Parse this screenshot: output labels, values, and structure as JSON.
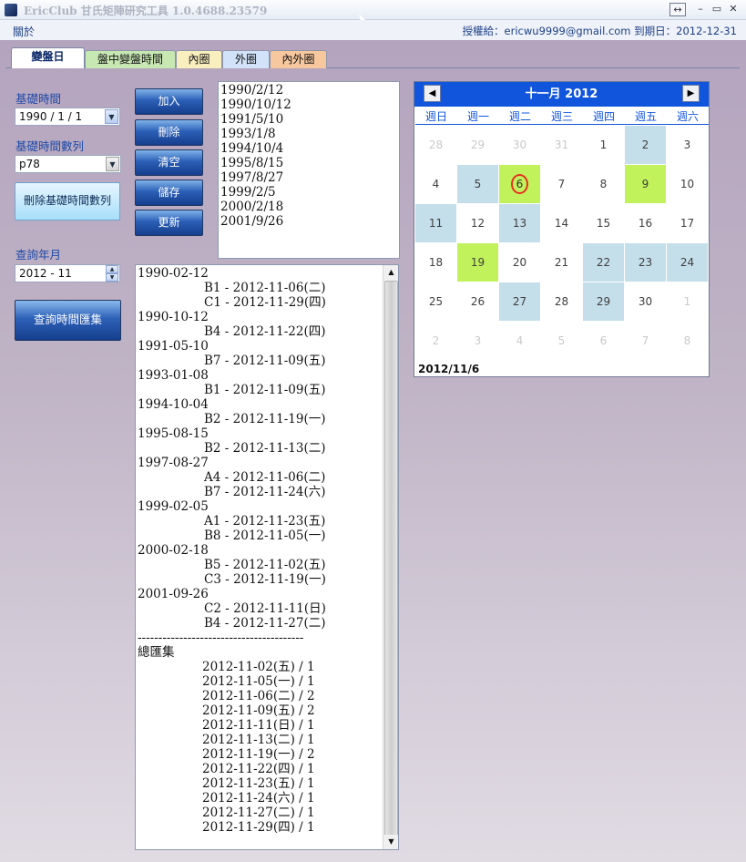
{
  "window": {
    "title": "EricClub 甘氏矩陣研究工具 1.0.4688.23579",
    "buttons": {
      "resize": "↔",
      "minimize": "–",
      "maximize": "▭",
      "close": "✕"
    }
  },
  "menu": {
    "about": "關於"
  },
  "license": "授權給：ericwu9999@gmail.com   到期日：2012-12-31",
  "tabs": [
    "變盤日",
    "盤中變盤時間",
    "內圈",
    "外圈",
    "內外圈"
  ],
  "tab_colors": [
    "#ffffff",
    "#c7e7b3",
    "#f9eebd",
    "#d2e3f9",
    "#f7c89e"
  ],
  "form": {
    "base_time_label": "基礎時間",
    "base_time_value": "1990 / 1 / 1",
    "series_label": "基礎時間數列",
    "series_value": "p78",
    "delete_series_button": "刪除基礎時間數列",
    "query_month_label": "查詢年月",
    "query_month_value": "2012 - 11",
    "query_button": "查詢時間匯集"
  },
  "actions": {
    "add": "加入",
    "delete": "刪除",
    "clear": "清空",
    "save": "儲存",
    "update": "更新"
  },
  "date_list": [
    "1990/2/12",
    "1990/10/12",
    "1991/5/10",
    "1993/1/8",
    "1994/10/4",
    "1995/8/15",
    "1997/8/27",
    "1999/2/5",
    "2000/2/18",
    "2001/9/26"
  ],
  "results": [
    {
      "text": "1990-02-12",
      "indent": false
    },
    {
      "text": "B1 - 2012-11-06(二)",
      "indent": true
    },
    {
      "text": "C1 - 2012-11-29(四)",
      "indent": true
    },
    {
      "text": "1990-10-12",
      "indent": false
    },
    {
      "text": "B4 - 2012-11-22(四)",
      "indent": true
    },
    {
      "text": "1991-05-10",
      "indent": false
    },
    {
      "text": "B7 - 2012-11-09(五)",
      "indent": true
    },
    {
      "text": "1993-01-08",
      "indent": false
    },
    {
      "text": "B1 - 2012-11-09(五)",
      "indent": true
    },
    {
      "text": "1994-10-04",
      "indent": false
    },
    {
      "text": "B2 - 2012-11-19(一)",
      "indent": true
    },
    {
      "text": "1995-08-15",
      "indent": false
    },
    {
      "text": "B2 - 2012-11-13(二)",
      "indent": true
    },
    {
      "text": "1997-08-27",
      "indent": false
    },
    {
      "text": "A4 - 2012-11-06(二)",
      "indent": true
    },
    {
      "text": "B7 - 2012-11-24(六)",
      "indent": true
    },
    {
      "text": "1999-02-05",
      "indent": false
    },
    {
      "text": "A1 - 2012-11-23(五)",
      "indent": true
    },
    {
      "text": "B8 - 2012-11-05(一)",
      "indent": true
    },
    {
      "text": "2000-02-18",
      "indent": false
    },
    {
      "text": "B5 - 2012-11-02(五)",
      "indent": true
    },
    {
      "text": "C3 - 2012-11-19(一)",
      "indent": true
    },
    {
      "text": "2001-09-26",
      "indent": false
    },
    {
      "text": "C2 - 2012-11-11(日)",
      "indent": true
    },
    {
      "text": "B4 - 2012-11-27(二)",
      "indent": true
    },
    {
      "text": "----------------------------------------",
      "indent": false
    },
    {
      "text": "總匯集",
      "indent": false
    },
    {
      "text": "2012-11-02(五) / 1",
      "indent": true
    },
    {
      "text": "2012-11-05(一) / 1",
      "indent": true
    },
    {
      "text": "2012-11-06(二) / 2",
      "indent": true
    },
    {
      "text": "2012-11-09(五) / 2",
      "indent": true
    },
    {
      "text": "2012-11-11(日) / 1",
      "indent": true
    },
    {
      "text": "2012-11-13(二) / 1",
      "indent": true
    },
    {
      "text": "2012-11-19(一) / 2",
      "indent": true
    },
    {
      "text": "2012-11-22(四) / 1",
      "indent": true
    },
    {
      "text": "2012-11-23(五) / 1",
      "indent": true
    },
    {
      "text": "2012-11-24(六) / 1",
      "indent": true
    },
    {
      "text": "2012-11-27(二) / 1",
      "indent": true
    },
    {
      "text": "2012-11-29(四) / 1",
      "indent": true
    }
  ],
  "calendar": {
    "title": "十一月 2012",
    "prev": "◀",
    "next": "▶",
    "weekdays": [
      "週日",
      "週一",
      "週二",
      "週三",
      "週四",
      "週五",
      "週六"
    ],
    "days": [
      {
        "d": "28",
        "s": "other"
      },
      {
        "d": "29",
        "s": "other"
      },
      {
        "d": "30",
        "s": "other"
      },
      {
        "d": "31",
        "s": "other"
      },
      {
        "d": "1",
        "s": ""
      },
      {
        "d": "2",
        "s": "blue"
      },
      {
        "d": "3",
        "s": ""
      },
      {
        "d": "4",
        "s": ""
      },
      {
        "d": "5",
        "s": "blue"
      },
      {
        "d": "6",
        "s": "green"
      },
      {
        "d": "7",
        "s": ""
      },
      {
        "d": "8",
        "s": ""
      },
      {
        "d": "9",
        "s": "green"
      },
      {
        "d": "10",
        "s": ""
      },
      {
        "d": "11",
        "s": "blue"
      },
      {
        "d": "12",
        "s": ""
      },
      {
        "d": "13",
        "s": "blue"
      },
      {
        "d": "14",
        "s": ""
      },
      {
        "d": "15",
        "s": ""
      },
      {
        "d": "16",
        "s": ""
      },
      {
        "d": "17",
        "s": ""
      },
      {
        "d": "18",
        "s": ""
      },
      {
        "d": "19",
        "s": "green"
      },
      {
        "d": "20",
        "s": ""
      },
      {
        "d": "21",
        "s": ""
      },
      {
        "d": "22",
        "s": "blue"
      },
      {
        "d": "23",
        "s": "blue"
      },
      {
        "d": "24",
        "s": "blue"
      },
      {
        "d": "25",
        "s": ""
      },
      {
        "d": "26",
        "s": ""
      },
      {
        "d": "27",
        "s": "blue"
      },
      {
        "d": "28",
        "s": ""
      },
      {
        "d": "29",
        "s": "blue"
      },
      {
        "d": "30",
        "s": ""
      },
      {
        "d": "1",
        "s": "other"
      },
      {
        "d": "2",
        "s": "other"
      },
      {
        "d": "3",
        "s": "other"
      },
      {
        "d": "4",
        "s": "other"
      },
      {
        "d": "5",
        "s": "other"
      },
      {
        "d": "6",
        "s": "other"
      },
      {
        "d": "7",
        "s": "other"
      },
      {
        "d": "8",
        "s": "other"
      }
    ],
    "today_index": 9,
    "selected_date": "2012/11/6"
  }
}
